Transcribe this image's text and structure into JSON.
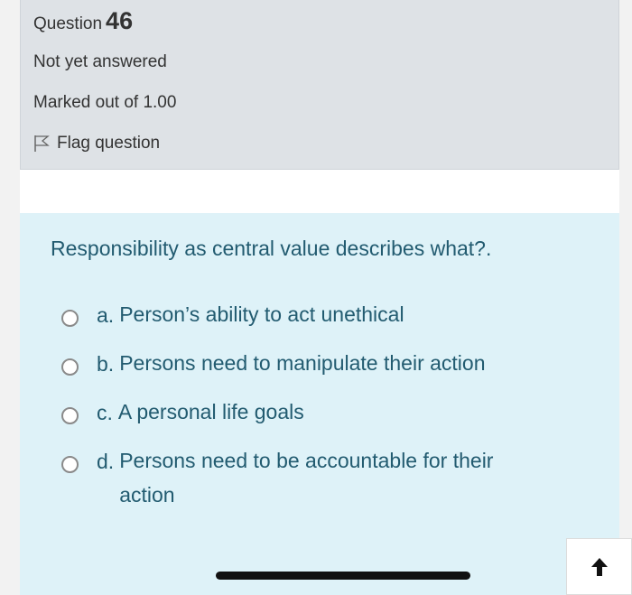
{
  "question": {
    "label": "Question",
    "number": "46",
    "state": "Not yet answered",
    "grade": "Marked out of 1.00",
    "flag_label": "Flag question"
  },
  "prompt": "Responsibility as central value describes what?.",
  "answers": [
    {
      "letter": "a.",
      "text": "Person’s ability to act unethical"
    },
    {
      "letter": "b.",
      "text": "Persons need to manipulate their action"
    },
    {
      "letter": "c.",
      "text": "A personal life goals"
    },
    {
      "letter": "d.",
      "text": "Persons need to be accountable for their action"
    }
  ],
  "colors": {
    "info_bg": "#dee2e6",
    "content_bg": "#def2f8",
    "text_accent": "#225b70"
  }
}
